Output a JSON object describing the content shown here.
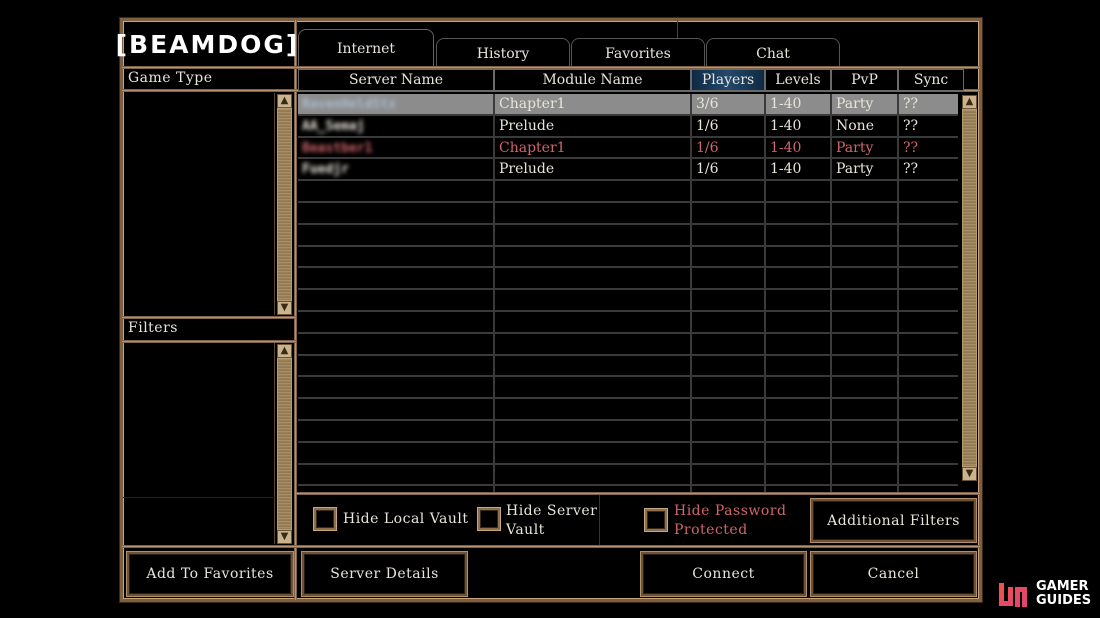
{
  "app": {
    "logo_text": "[BEAMDOG]"
  },
  "tabs": [
    {
      "label": "Internet",
      "active": true
    },
    {
      "label": "History",
      "active": false
    },
    {
      "label": "Favorites",
      "active": false
    },
    {
      "label": "Chat",
      "active": false
    }
  ],
  "sidebar": {
    "game_type_label": "Game Type",
    "filters_label": "Filters"
  },
  "table": {
    "columns": [
      "Server Name",
      "Module Name",
      "Players",
      "Levels",
      "PvP",
      "Sync"
    ],
    "sorted_column": "Players",
    "rows": [
      {
        "server": "RavenHeldStx",
        "module": "Chapter1",
        "players": "3/6",
        "levels": "1-40",
        "pvp": "Party",
        "sync": "??",
        "style": "selected"
      },
      {
        "server": "AA_Semaj",
        "module": "Prelude",
        "players": "1/6",
        "levels": "1-40",
        "pvp": "None",
        "sync": "??",
        "style": "normal"
      },
      {
        "server": "Beastber1",
        "module": "Chapter1",
        "players": "1/6",
        "levels": "1-40",
        "pvp": "Party",
        "sync": "??",
        "style": "password"
      },
      {
        "server": "Fuedjr",
        "module": "Prelude",
        "players": "1/6",
        "levels": "1-40",
        "pvp": "Party",
        "sync": "??",
        "style": "normal"
      }
    ],
    "empty_rows": 14
  },
  "filters": {
    "hide_local_vault": {
      "label": "Hide Local Vault",
      "checked": false
    },
    "hide_server_vault": {
      "label_line1": "Hide Server",
      "label_line2": "Vault",
      "checked": false
    },
    "hide_password_protected": {
      "label_line1": "Hide Password",
      "label_line2": "Protected",
      "checked": false
    },
    "additional_filters_label": "Additional Filters"
  },
  "buttons": {
    "add_to_favorites": "Add To Favorites",
    "server_details": "Server Details",
    "connect": "Connect",
    "cancel": "Cancel"
  },
  "colors": {
    "password_protected_text": "#d0656a",
    "selected_row_bg": "#8c8c8c",
    "sorted_header_bg": "#23486b",
    "frame_gold": "#c9a27a"
  },
  "watermark": {
    "line1": "GAMER",
    "line2": "GUIDES"
  }
}
